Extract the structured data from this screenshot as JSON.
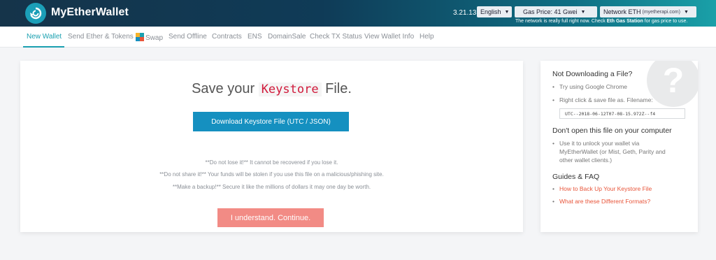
{
  "header": {
    "brand": "MyEtherWallet",
    "version": "3.21.13",
    "language": "English",
    "gas_price": "Gas Price: 41 Gwei",
    "network": "Network ETH",
    "network_api": "(myetherapi.com)",
    "network_note_pre": "The network is really full right now. Check ",
    "network_note_link": "Eth Gas Station",
    "network_note_post": " for gas price to use."
  },
  "nav": {
    "items": [
      "New Wallet",
      "Send Ether & Tokens",
      "Swap",
      "Send Offline",
      "Contracts",
      "ENS",
      "DomainSale",
      "Check TX Status",
      "View Wallet Info",
      "Help"
    ],
    "active": "New Wallet"
  },
  "main": {
    "title_pre": "Save your",
    "title_keyword": "Keystore",
    "title_post": "File.",
    "download_button": "Download Keystore File (UTC / JSON)",
    "warnings": [
      "**Do not lose it!** It cannot be recovered if you lose it.",
      "**Do not share it!** Your funds will be stolen if you use this file on a malicious/phishing site.",
      "**Make a backup!** Secure it like the millions of dollars it may one day be worth."
    ],
    "continue_button": "I understand. Continue."
  },
  "side": {
    "qmark": "?",
    "heading1": "Not Downloading a File?",
    "tip1": "Try using Google Chrome",
    "tip2": "Right click & save file as. Filename:",
    "filename": "UTC--2018-06-12T07-08-15.972Z--f4",
    "heading2": "Don't open this file on your computer",
    "tip3_line1": "Use it to unlock your wallet via",
    "tip3_line2": "MyEtherWallet (or Mist, Geth, Parity and",
    "tip3_line3": "other wallet clients.)",
    "heading3": "Guides & FAQ",
    "link1": "How to Back Up Your Keystore File",
    "link2": "What are these Different Formats?"
  },
  "colors": {
    "accent": "#1aa0b0",
    "primary_button": "#1590c0",
    "continue_button": "#f28b85",
    "link": "#e8553a"
  }
}
